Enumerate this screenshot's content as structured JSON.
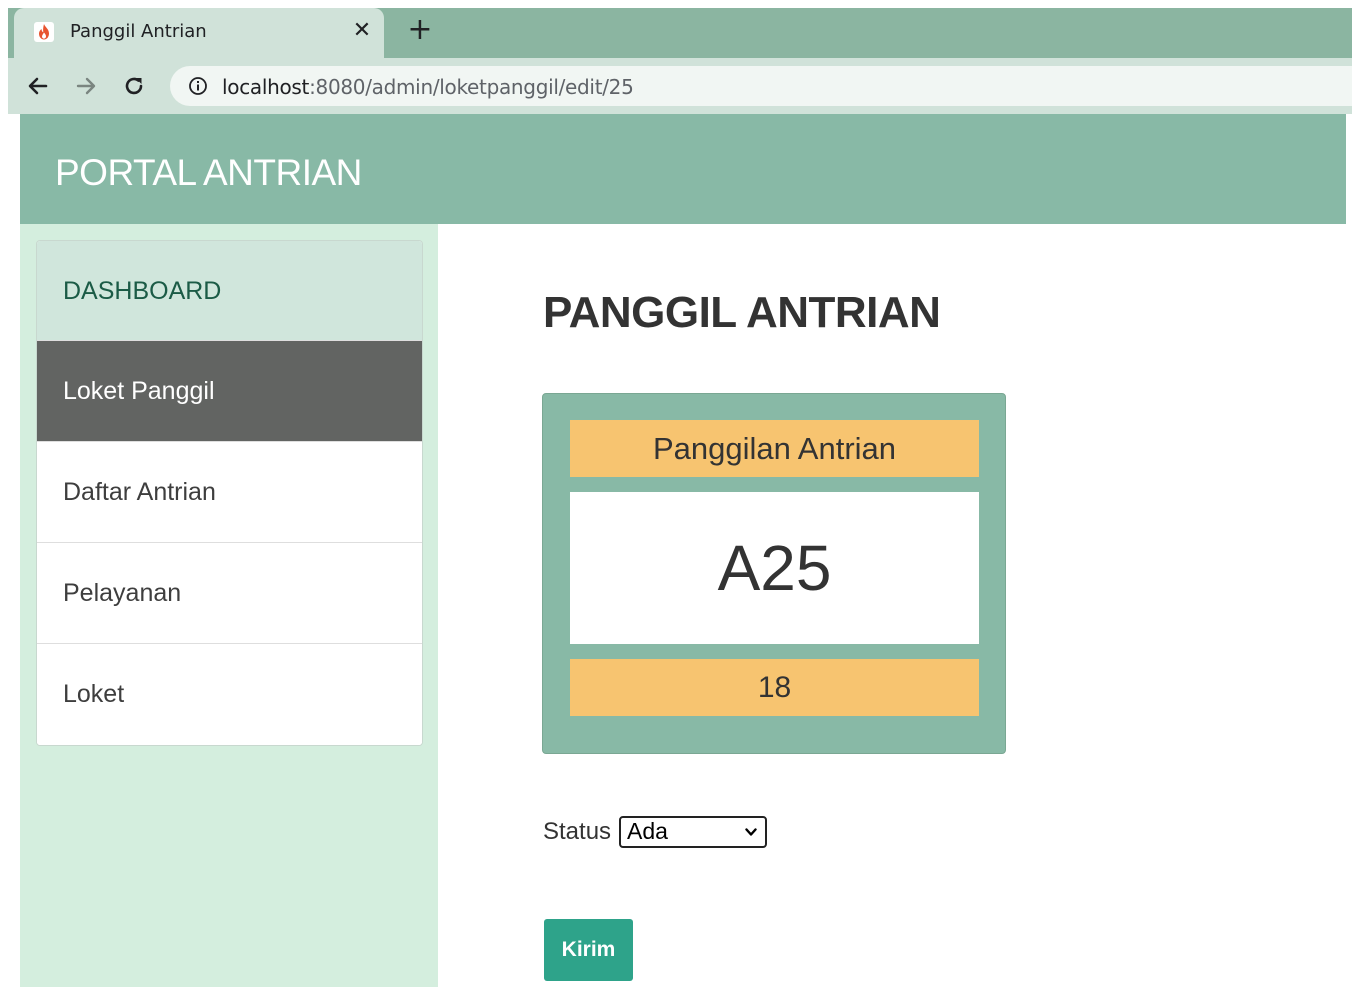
{
  "browser": {
    "tab_title": "Panggil Antrian",
    "tab_close_glyph": "✕",
    "new_tab_glyph": "+",
    "url_host": "localhost",
    "url_rest": ":8080/admin/loketpanggil/edit/25"
  },
  "header": {
    "brand": "PORTAL ANTRIAN"
  },
  "sidebar": {
    "items": [
      {
        "label": "DASHBOARD",
        "state": "header"
      },
      {
        "label": "Loket Panggil",
        "state": "active"
      },
      {
        "label": "Daftar Antrian",
        "state": "normal"
      },
      {
        "label": "Pelayanan",
        "state": "normal"
      },
      {
        "label": "Loket",
        "state": "normal"
      }
    ]
  },
  "main": {
    "title": "PANGGIL ANTRIAN",
    "card": {
      "heading": "Panggilan Antrian",
      "number": "A25",
      "footer": "18"
    },
    "status": {
      "label": "Status",
      "selected": "Ada"
    },
    "submit_label": "Kirim"
  },
  "colors": {
    "header_bg": "#88b9a6",
    "sidebar_bg": "#d4eede",
    "active_item_bg": "#626462",
    "card_bg": "#88b9a6",
    "card_accent": "#f7c470",
    "button_bg": "#2ea38a"
  },
  "icons": {
    "favicon": "flame-icon",
    "back": "arrow-left-icon",
    "forward": "arrow-right-icon",
    "reload": "reload-icon",
    "site_info": "info-icon",
    "select_chevron": "chevron-down-icon"
  }
}
